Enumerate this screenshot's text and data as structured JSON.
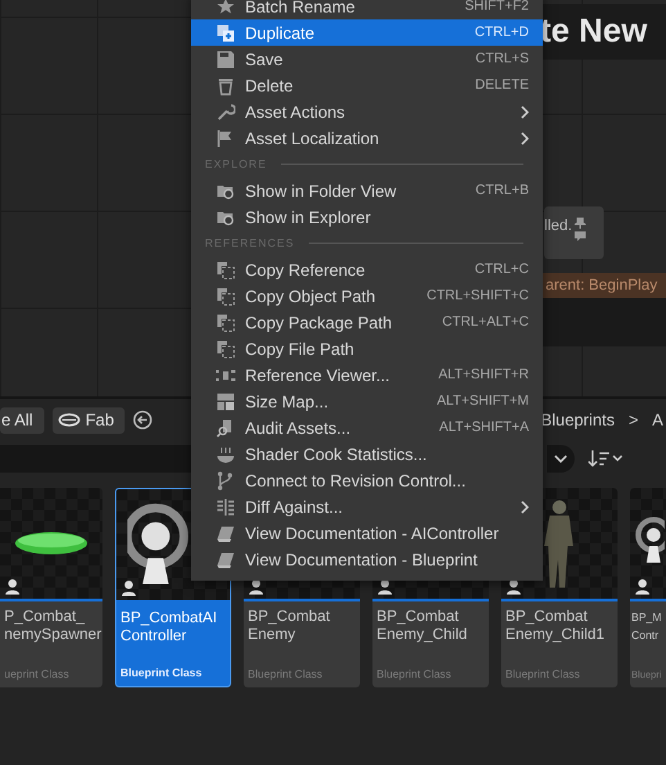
{
  "graph": {
    "title_fragment": "te New",
    "comment_text": "lled.",
    "node_header": "arent: BeginPlay"
  },
  "toolbar": {
    "buttons": [
      {
        "label": "e All",
        "kind": "text"
      },
      {
        "label": "Fab",
        "kind": "fab"
      }
    ],
    "breadcrumb": [
      "Blueprints",
      ">",
      "A"
    ]
  },
  "assets": [
    {
      "lines": [
        "P_Combat_",
        "nemySpawner"
      ],
      "type": "ueprint Class",
      "selected": false
    },
    {
      "lines": [
        "BP_CombatAI",
        "Controller"
      ],
      "type": "Blueprint Class",
      "selected": true
    },
    {
      "lines": [
        "BP_Combat",
        "Enemy"
      ],
      "type": "Blueprint Class",
      "selected": false
    },
    {
      "lines": [
        "BP_Combat",
        "Enemy_Child"
      ],
      "type": "Blueprint Class",
      "selected": false
    },
    {
      "lines": [
        "BP_Combat",
        "Enemy_Child1"
      ],
      "type": "Blueprint Class",
      "selected": false
    },
    {
      "lines": [
        "BP_M",
        "Contr"
      ],
      "type": "Bluepri",
      "selected": false
    }
  ],
  "context_menu": {
    "items": [
      {
        "kind": "item",
        "label": "Batch Rename",
        "shortcut": "SHIFT+F2",
        "submenu": false,
        "highlighted": false
      },
      {
        "kind": "item",
        "label": "Duplicate",
        "shortcut": "CTRL+D",
        "submenu": false,
        "highlighted": true
      },
      {
        "kind": "item",
        "label": "Save",
        "shortcut": "CTRL+S",
        "submenu": false,
        "highlighted": false
      },
      {
        "kind": "item",
        "label": "Delete",
        "shortcut": "DELETE",
        "submenu": false,
        "highlighted": false
      },
      {
        "kind": "item",
        "label": "Asset Actions",
        "submenu": true,
        "highlighted": false
      },
      {
        "kind": "item",
        "label": "Asset Localization",
        "submenu": true,
        "highlighted": false
      },
      {
        "kind": "header",
        "label": "EXPLORE"
      },
      {
        "kind": "item",
        "label": "Show in Folder View",
        "shortcut": "CTRL+B",
        "submenu": false,
        "highlighted": false
      },
      {
        "kind": "item",
        "label": "Show in Explorer",
        "submenu": false,
        "highlighted": false
      },
      {
        "kind": "header",
        "label": "REFERENCES"
      },
      {
        "kind": "item",
        "label": "Copy Reference",
        "shortcut": "CTRL+C",
        "submenu": false,
        "highlighted": false
      },
      {
        "kind": "item",
        "label": "Copy Object Path",
        "shortcut": "CTRL+SHIFT+C",
        "submenu": false,
        "highlighted": false
      },
      {
        "kind": "item",
        "label": "Copy Package Path",
        "shortcut": "CTRL+ALT+C",
        "submenu": false,
        "highlighted": false
      },
      {
        "kind": "item",
        "label": "Copy File Path",
        "submenu": false,
        "highlighted": false
      },
      {
        "kind": "item",
        "label": "Reference Viewer...",
        "shortcut": "ALT+SHIFT+R",
        "submenu": false,
        "highlighted": false
      },
      {
        "kind": "item",
        "label": "Size Map...",
        "shortcut": "ALT+SHIFT+M",
        "submenu": false,
        "highlighted": false
      },
      {
        "kind": "item",
        "label": "Audit Assets...",
        "shortcut": "ALT+SHIFT+A",
        "submenu": false,
        "highlighted": false
      },
      {
        "kind": "item",
        "label": "Shader Cook Statistics...",
        "submenu": false,
        "highlighted": false
      },
      {
        "kind": "item",
        "label": "Connect to Revision Control...",
        "submenu": false,
        "highlighted": false
      },
      {
        "kind": "item",
        "label": "Diff Against...",
        "submenu": true,
        "highlighted": false
      },
      {
        "kind": "item",
        "label": "View Documentation - AIController",
        "submenu": false,
        "highlighted": false
      },
      {
        "kind": "item",
        "label": "View Documentation - Blueprint",
        "submenu": false,
        "highlighted": false
      }
    ]
  }
}
